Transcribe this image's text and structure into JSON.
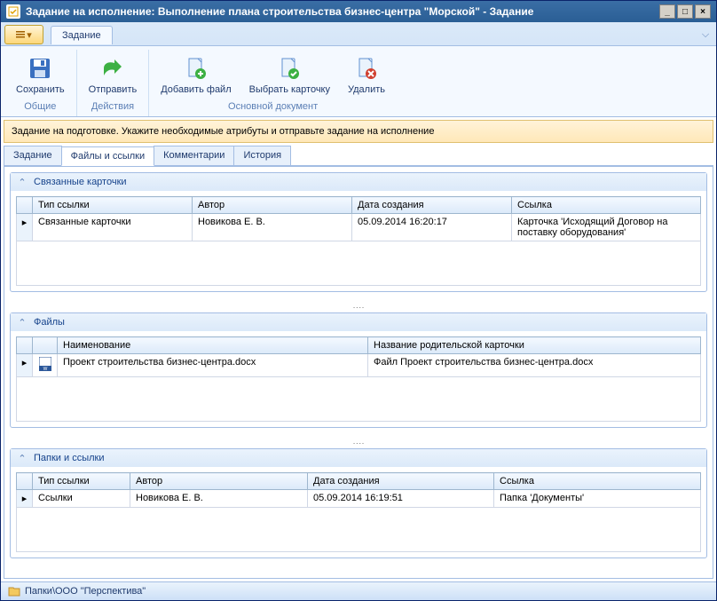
{
  "window": {
    "title": "Задание на исполнение: Выполнение плана строительства бизнес-центра \"Морской\" - Задание"
  },
  "ribbon": {
    "tab_label": "Задание",
    "groups": {
      "common": {
        "title": "Общие",
        "save": "Сохранить"
      },
      "actions": {
        "title": "Действия",
        "send": "Отправить"
      },
      "maindoc": {
        "title": "Основной документ",
        "add_file": "Добавить файл",
        "select_card": "Выбрать карточку",
        "delete": "Удалить"
      }
    }
  },
  "info": {
    "text": "Задание на подготовке. Укажите необходимые атрибуты и отправьте задание на исполнение"
  },
  "tabs": {
    "task": "Задание",
    "files": "Файлы и ссылки",
    "comments": "Комментарии",
    "history": "История"
  },
  "panels": {
    "related": {
      "title": "Связанные карточки",
      "cols": {
        "type": "Тип ссылки",
        "author": "Автор",
        "created": "Дата создания",
        "link": "Ссылка"
      },
      "rows": [
        {
          "type": "Связанные карточки",
          "author": "Новикова Е. В.",
          "created": "05.09.2014 16:20:17",
          "link": "Карточка 'Исходящий Договор на поставку оборудования'"
        }
      ]
    },
    "files": {
      "title": "Файлы",
      "cols": {
        "name": "Наименование",
        "parent": "Название родительской карточки"
      },
      "rows": [
        {
          "name": "Проект строительства бизнес-центра.docx",
          "parent": "Файл Проект строительства бизнес-центра.docx"
        }
      ]
    },
    "folders": {
      "title": "Папки и ссылки",
      "cols": {
        "type": "Тип ссылки",
        "author": "Автор",
        "created": "Дата создания",
        "link": "Ссылка"
      },
      "rows": [
        {
          "type": "Ссылки",
          "author": "Новикова Е. В.",
          "created": "05.09.2014 16:19:51",
          "link": "Папка 'Документы'"
        }
      ]
    }
  },
  "status": {
    "path": "Папки\\ООО \"Перспектива\""
  }
}
